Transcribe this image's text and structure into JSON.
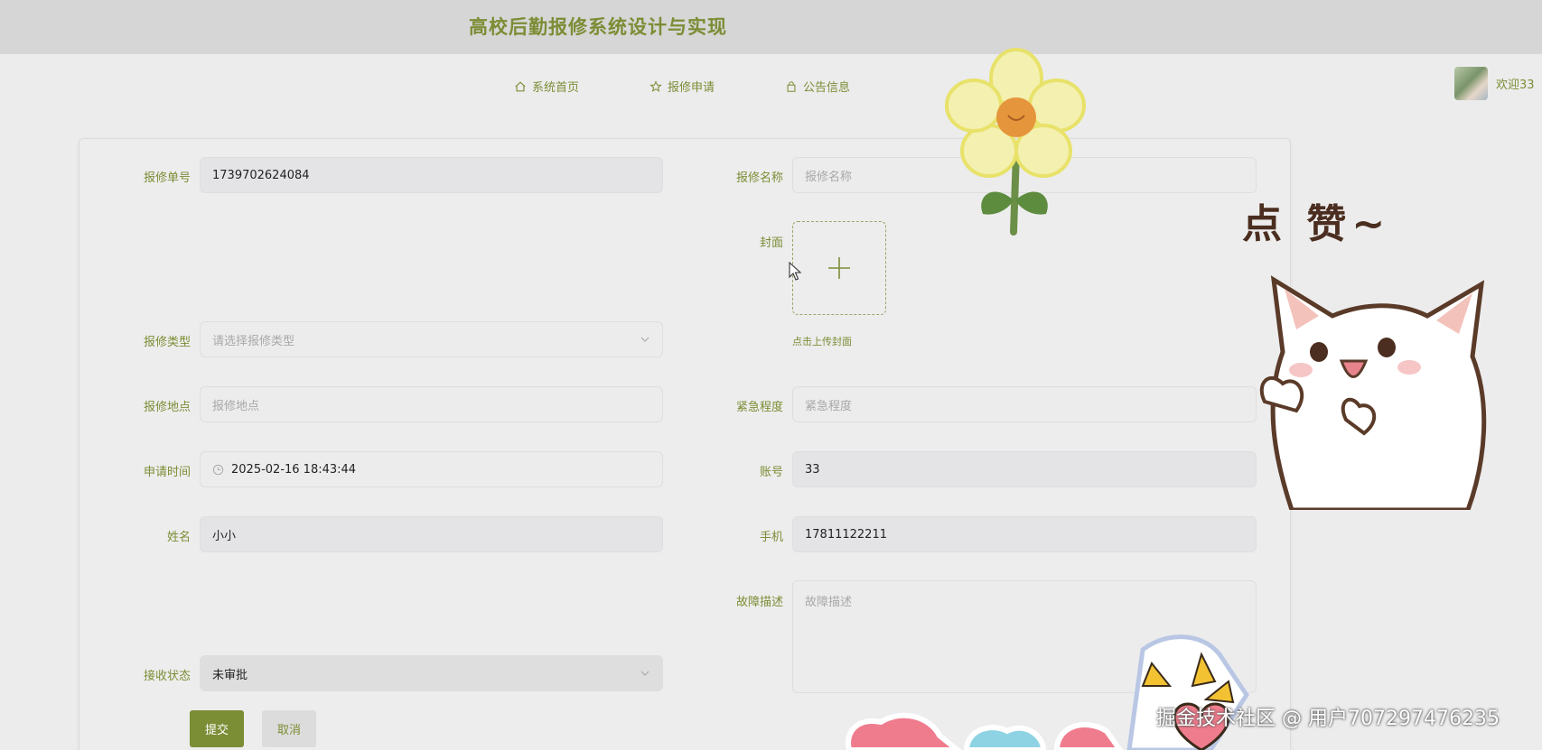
{
  "header": {
    "title": "高校后勤报修系统设计与实现"
  },
  "nav": {
    "items": [
      {
        "label": "系统首页",
        "icon": "home-icon"
      },
      {
        "label": "报修申请",
        "icon": "star-icon"
      },
      {
        "label": "公告信息",
        "icon": "bag-icon"
      }
    ]
  },
  "user": {
    "welcome": "欢迎33"
  },
  "form": {
    "repair_no": {
      "label": "报修单号",
      "value": "1739702624084"
    },
    "repair_name": {
      "label": "报修名称",
      "placeholder": "报修名称"
    },
    "cover": {
      "label": "封面",
      "hint": "点击上传封面"
    },
    "repair_type": {
      "label": "报修类型",
      "placeholder": "请选择报修类型"
    },
    "location": {
      "label": "报修地点",
      "placeholder": "报修地点"
    },
    "urgency": {
      "label": "紧急程度",
      "placeholder": "紧急程度"
    },
    "apply_time": {
      "label": "申请时间",
      "value": "2025-02-16 18:43:44"
    },
    "account": {
      "label": "账号",
      "value": "33"
    },
    "name": {
      "label": "姓名",
      "value": "小小"
    },
    "phone": {
      "label": "手机",
      "value": "17811122211"
    },
    "description": {
      "label": "故障描述",
      "placeholder": "故障描述"
    },
    "receive_status": {
      "label": "接收状态",
      "value": "未审批"
    },
    "submit_label": "提交",
    "cancel_label": "取消"
  },
  "stickers": {
    "like_text": "点 赞~"
  },
  "watermark": "掘金技术社区 @ 用户707297476235",
  "colors": {
    "accent": "#7b8d35",
    "topbar": "#d6d6d6",
    "background": "#ececec"
  }
}
